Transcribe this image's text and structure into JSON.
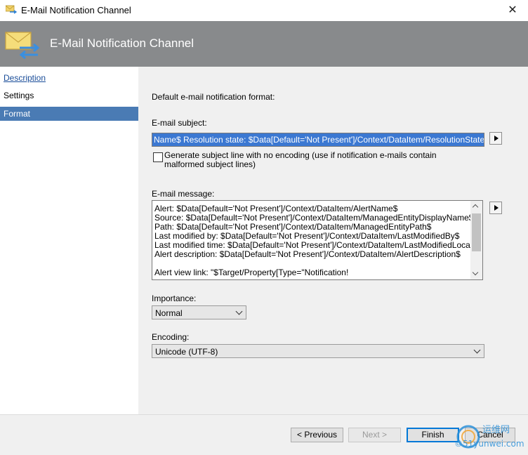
{
  "window": {
    "title": "E-Mail Notification Channel"
  },
  "banner": {
    "title": "E-Mail Notification Channel"
  },
  "sidebar": {
    "items": [
      {
        "label": "Description"
      },
      {
        "label": "Settings"
      },
      {
        "label": "Format"
      }
    ]
  },
  "content": {
    "default_format_label": "Default e-mail notification format:",
    "subject_label": "E-mail subject:",
    "subject_value": "Name$ Resolution state: $Data[Default='Not Present']/Context/DataItem/ResolutionStateName$",
    "no_encoding_label": "Generate subject line with no encoding (use if notification e-mails contain malformed subject lines)",
    "message_label": "E-mail message:",
    "message_lines": [
      "Alert: $Data[Default='Not Present']/Context/DataItem/AlertName$",
      "Source: $Data[Default='Not Present']/Context/DataItem/ManagedEntityDisplayName$",
      "Path: $Data[Default='Not Present']/Context/DataItem/ManagedEntityPath$",
      "Last modified by: $Data[Default='Not Present']/Context/DataItem/LastModifiedBy$",
      "Last modified time: $Data[Default='Not Present']/Context/DataItem/LastModifiedLocal$",
      "Alert description: $Data[Default='Not Present']/Context/DataItem/AlertDescription$",
      "",
      "Alert view link: \"$Target/Property[Type=\"Notification!"
    ],
    "importance_label": "Importance:",
    "importance_value": "Normal",
    "encoding_label": "Encoding:",
    "encoding_value": "Unicode (UTF-8)"
  },
  "footer": {
    "previous": "< Previous",
    "next": "Next >",
    "finish": "Finish",
    "cancel": "Cancel"
  },
  "colors": {
    "selection": "#4a7bb4",
    "banner": "#888a8c",
    "highlight": "#3b78d2"
  },
  "icons": [
    "mail-notification-icon",
    "close-icon",
    "arrow-right-icon",
    "chevron-down-icon"
  ]
}
